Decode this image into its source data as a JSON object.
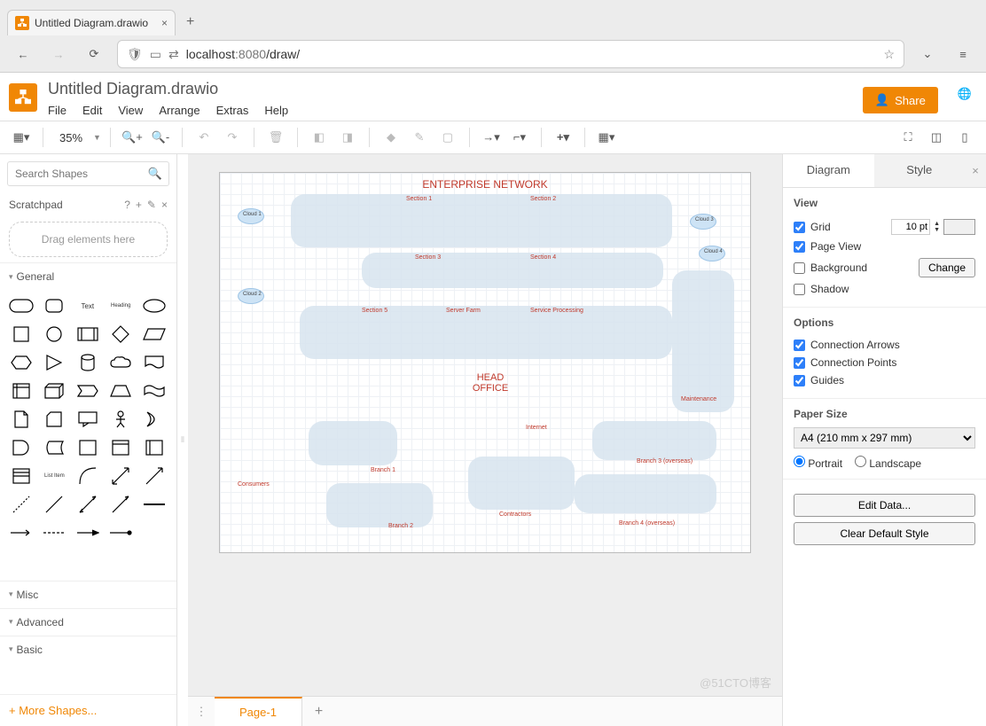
{
  "browser": {
    "tab_title": "Untitled Diagram.drawio",
    "url_host": "localhost",
    "url_port": ":8080",
    "url_path": "/draw/"
  },
  "app": {
    "title": "Untitled Diagram.drawio",
    "menu": [
      "File",
      "Edit",
      "View",
      "Arrange",
      "Extras",
      "Help"
    ],
    "share_label": "Share",
    "zoom": "35%"
  },
  "left": {
    "search_placeholder": "Search Shapes",
    "scratchpad_label": "Scratchpad",
    "scratchpad_hint": "?",
    "drag_hint": "Drag elements here",
    "sections": [
      "General",
      "Misc",
      "Advanced",
      "Basic"
    ],
    "list_item_label": "List Item",
    "text_label": "Text",
    "heading_label": "Heading",
    "more_shapes": "+  More Shapes..."
  },
  "canvas": {
    "diagram_title": "ENTERPRISE NETWORK",
    "head_office": "HEAD\nOFFICE",
    "labels": {
      "section1": "Section 1",
      "section2": "Section 2",
      "section3": "Section 3",
      "section4": "Section 4",
      "section5": "Section 5",
      "server_farm": "Server Farm",
      "svc_proc": "Service Processing",
      "maintenance": "Maintenance",
      "consumers": "Consumers",
      "branch1": "Branch 1",
      "branch2": "Branch 2",
      "branch3": "Branch 3 (overseas)",
      "branch4": "Branch 4 (overseas)",
      "contractors": "Contractors",
      "internet": "Internet",
      "cloud1": "Cloud 1",
      "cloud2": "Cloud 2",
      "cloud3": "Cloud 3",
      "cloud4": "Cloud 4"
    },
    "page_tab": "Page-1"
  },
  "right": {
    "tab_diagram": "Diagram",
    "tab_style": "Style",
    "view_label": "View",
    "grid_label": "Grid",
    "grid_value": "10 pt",
    "pageview_label": "Page View",
    "background_label": "Background",
    "change_label": "Change",
    "shadow_label": "Shadow",
    "options_label": "Options",
    "conn_arrows": "Connection Arrows",
    "conn_points": "Connection Points",
    "guides": "Guides",
    "paper_label": "Paper Size",
    "paper_value": "A4 (210 mm x 297 mm)",
    "portrait": "Portrait",
    "landscape": "Landscape",
    "edit_data": "Edit Data...",
    "clear_style": "Clear Default Style"
  },
  "watermark": "@51CTO博客"
}
